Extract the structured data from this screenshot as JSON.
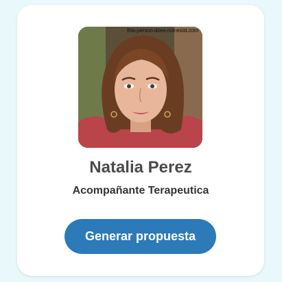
{
  "profile": {
    "name": "Natalia Perez",
    "role": "Acompañante Terapeutica",
    "photo_watermark": "this-person-does-not-exist.com"
  },
  "actions": {
    "generate_label": "Generar propuesta"
  },
  "colors": {
    "page_background": "#e9f9fb",
    "card_background": "#ffffff",
    "button_background": "#2c7ab8",
    "name_text": "#4a4a4a",
    "role_text": "#333333"
  }
}
